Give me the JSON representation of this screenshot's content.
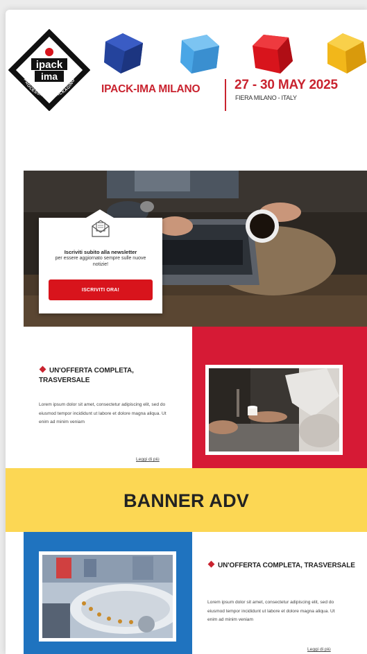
{
  "header": {
    "logo_text_top": "ipack",
    "logo_text_bottom": "ima",
    "logo_ring_text": "PROCESSING & PACKAGING",
    "event_name": "IPACK-IMA MILANO",
    "event_dates": "27 - 30 MAY 2025",
    "event_venue": "FIERA MILANO - ITALY",
    "cube_colors": [
      "#24439c",
      "#4aa6e6",
      "#d8141c",
      "#f2b71a"
    ]
  },
  "newsletter": {
    "title": "Iscriviti subito alla newsletter",
    "subtitle": "per essere aggiornato sempre sulle nuove notizie!",
    "button_label": "ISCRIVITI ORA!"
  },
  "section1": {
    "heading": "UN'OFFERTA COMPLETA, TRASVERSALE",
    "body": "Lorem ipsum dolor sit amet, consectetur adipiscing elit, sed do eiusmod tempor incididunt ut labore et dolore magna aliqua. Ut enim ad minim veniam",
    "link": "Leggi di più",
    "panel_color": "#d61a35"
  },
  "banner": {
    "label": "BANNER ADV",
    "color": "#fcd754"
  },
  "section2": {
    "heading": "UN'OFFERTA COMPLETA, TRASVERSALE",
    "body": "Lorem ipsum dolor sit amet, consectetur adipiscing elit, sed do eiusmod tempor incididunt ut labore et dolore magna aliqua. Ut enim ad minim veniam",
    "link": "Leggi di più",
    "panel_color": "#1f73bf"
  }
}
